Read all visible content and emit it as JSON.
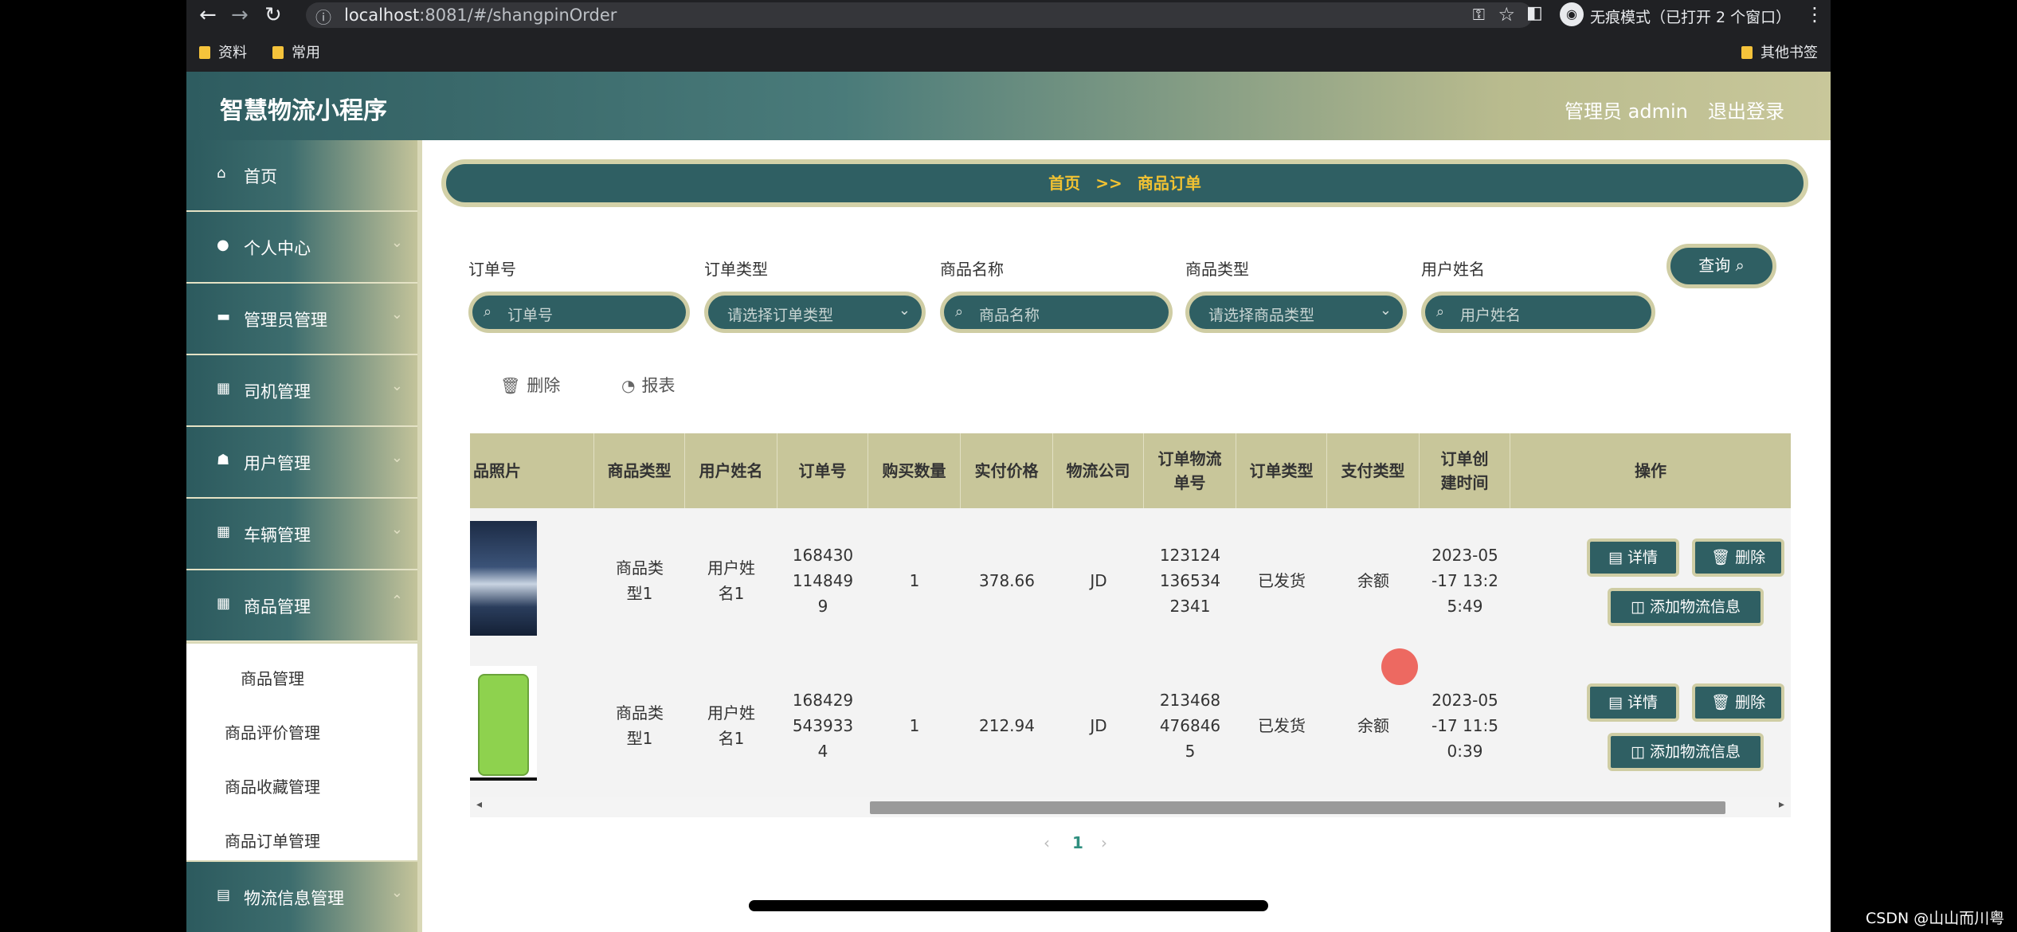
{
  "browser": {
    "url_prefix": "localhost",
    "url_rest": ":8081/#/shangpinOrder",
    "incognito_label": "无痕模式（已打开 2 个窗口）",
    "bookmarks": [
      "资料",
      "常用"
    ],
    "other_bookmarks": "其他书签"
  },
  "app": {
    "title": "智慧物流小程序",
    "user_label": "管理员 admin",
    "logout_label": "退出登录"
  },
  "sidebar": {
    "items": [
      {
        "label": "首页",
        "icon": "home-icon"
      },
      {
        "label": "个人中心",
        "icon": "user-icon"
      },
      {
        "label": "管理员管理",
        "icon": "monitor-icon"
      },
      {
        "label": "司机管理",
        "icon": "grid-icon"
      },
      {
        "label": "用户管理",
        "icon": "thumb-icon"
      },
      {
        "label": "车辆管理",
        "icon": "grid-icon"
      },
      {
        "label": "商品管理",
        "icon": "grid-icon"
      }
    ],
    "submenu": [
      "商品管理",
      "商品评价管理",
      "商品收藏管理",
      "商品订单管理"
    ],
    "last_item": {
      "label": "物流信息管理",
      "icon": "doc-icon"
    }
  },
  "breadcrumb": {
    "home": "首页",
    "sep": ">>",
    "current": "商品订单"
  },
  "filters": {
    "order_no": {
      "label": "订单号",
      "placeholder": "订单号"
    },
    "order_type": {
      "label": "订单类型",
      "placeholder": "请选择订单类型"
    },
    "product_name": {
      "label": "商品名称",
      "placeholder": "商品名称"
    },
    "product_type": {
      "label": "商品类型",
      "placeholder": "请选择商品类型"
    },
    "user_name": {
      "label": "用户姓名",
      "placeholder": "用户姓名"
    },
    "query_label": "查询"
  },
  "toolbar": {
    "delete_label": "删除",
    "report_label": "报表"
  },
  "table": {
    "headers": [
      "品照片",
      "商品类型",
      "用户姓名",
      "订单号",
      "购买数量",
      "实付价格",
      "物流公司",
      "订单物流单号",
      "订单类型",
      "支付类型",
      "订单创建时间",
      "操作"
    ],
    "rows": [
      {
        "type": "商品类型1",
        "user": "用户姓名1",
        "order_no": "1684301148499",
        "qty": "1",
        "price": "378.66",
        "company": "JD",
        "tracking": "1231241365342341",
        "order_type": "已发货",
        "pay_type": "余额",
        "created": "2023-05-17 13:25:49"
      },
      {
        "type": "商品类型1",
        "user": "用户姓名1",
        "order_no": "1684295439334",
        "qty": "1",
        "price": "212.94",
        "company": "JD",
        "tracking": "2134684768465",
        "order_type": "已发货",
        "pay_type": "余额",
        "created": "2023-05-17 11:50:39"
      }
    ],
    "actions": {
      "detail": "详情",
      "delete": "删除",
      "add_logistics": "添加物流信息"
    }
  },
  "pagination": {
    "prev": "‹",
    "current": "1",
    "next": "›"
  },
  "watermark": "CSDN @山山而川粤"
}
